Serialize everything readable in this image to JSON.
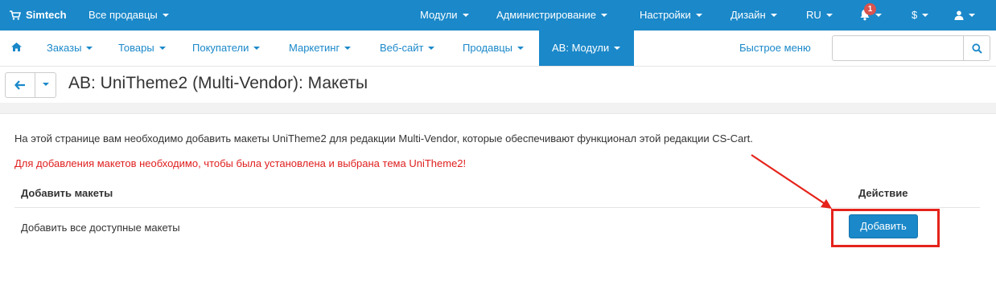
{
  "topbar": {
    "brand": "Simtech",
    "vendors_select": "Все продавцы",
    "menu": [
      {
        "label": "Модули"
      },
      {
        "label": "Администрирование"
      },
      {
        "label": "Настройки"
      },
      {
        "label": "Дизайн"
      },
      {
        "label": "RU"
      }
    ],
    "notification_count": "1",
    "currency": "$",
    "colors": {
      "bar": "#1a88c9",
      "badge": "#d9534f"
    }
  },
  "navbar": {
    "items": [
      {
        "label": "Заказы"
      },
      {
        "label": "Товары"
      },
      {
        "label": "Покупатели"
      },
      {
        "label": "Маркетинг"
      },
      {
        "label": "Веб-сайт"
      },
      {
        "label": "Продавцы"
      },
      {
        "label": "AB: Модули",
        "active": true
      }
    ],
    "quick_menu": "Быстрое меню",
    "search": {
      "value": "",
      "placeholder": ""
    }
  },
  "header": {
    "title": "AB: UniTheme2 (Multi-Vendor): Макеты"
  },
  "content": {
    "description": "На этой странице вам необходимо добавить макеты UniTheme2 для редакции Multi-Vendor, которые обеспечивают функционал этой редакции CS-Cart.",
    "warning": "Для добавления макетов необходимо, чтобы была установлена и выбрана тема UniTheme2!",
    "table": {
      "headers": [
        "Добавить макеты",
        "Действие"
      ],
      "rows": [
        {
          "name": "Добавить все доступные макеты",
          "action": "Добавить"
        }
      ]
    },
    "colors": {
      "warning": "#e02020",
      "annotation": "#e5231b"
    }
  }
}
